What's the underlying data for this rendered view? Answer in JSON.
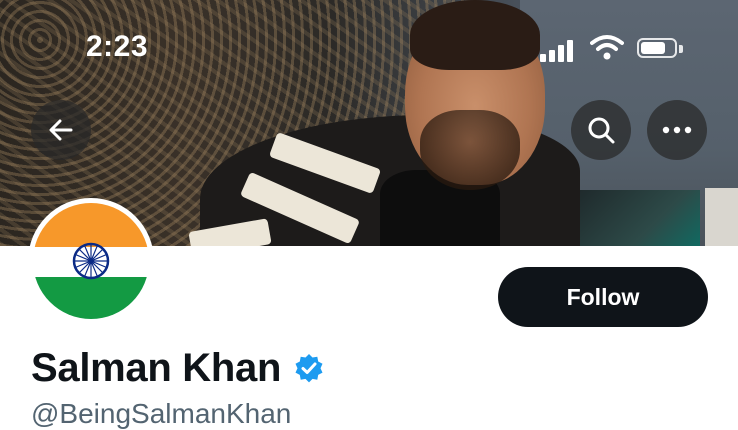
{
  "status_bar": {
    "time": "2:23",
    "icons": [
      "cellular-signal-icon",
      "wifi-icon",
      "battery-icon"
    ]
  },
  "header": {
    "icons": [
      "back-arrow-icon",
      "search-icon",
      "more-options-icon"
    ]
  },
  "profile": {
    "name": "Salman Khan",
    "handle": "@BeingSalmanKhan",
    "verified": true,
    "avatar": "india-flag"
  },
  "actions": {
    "follow_label": "Follow"
  },
  "colors": {
    "primary_text": "#0f1419",
    "secondary_text": "#536471",
    "verified_blue": "#1d9bf0",
    "follow_button_bg": "#0f1419"
  }
}
